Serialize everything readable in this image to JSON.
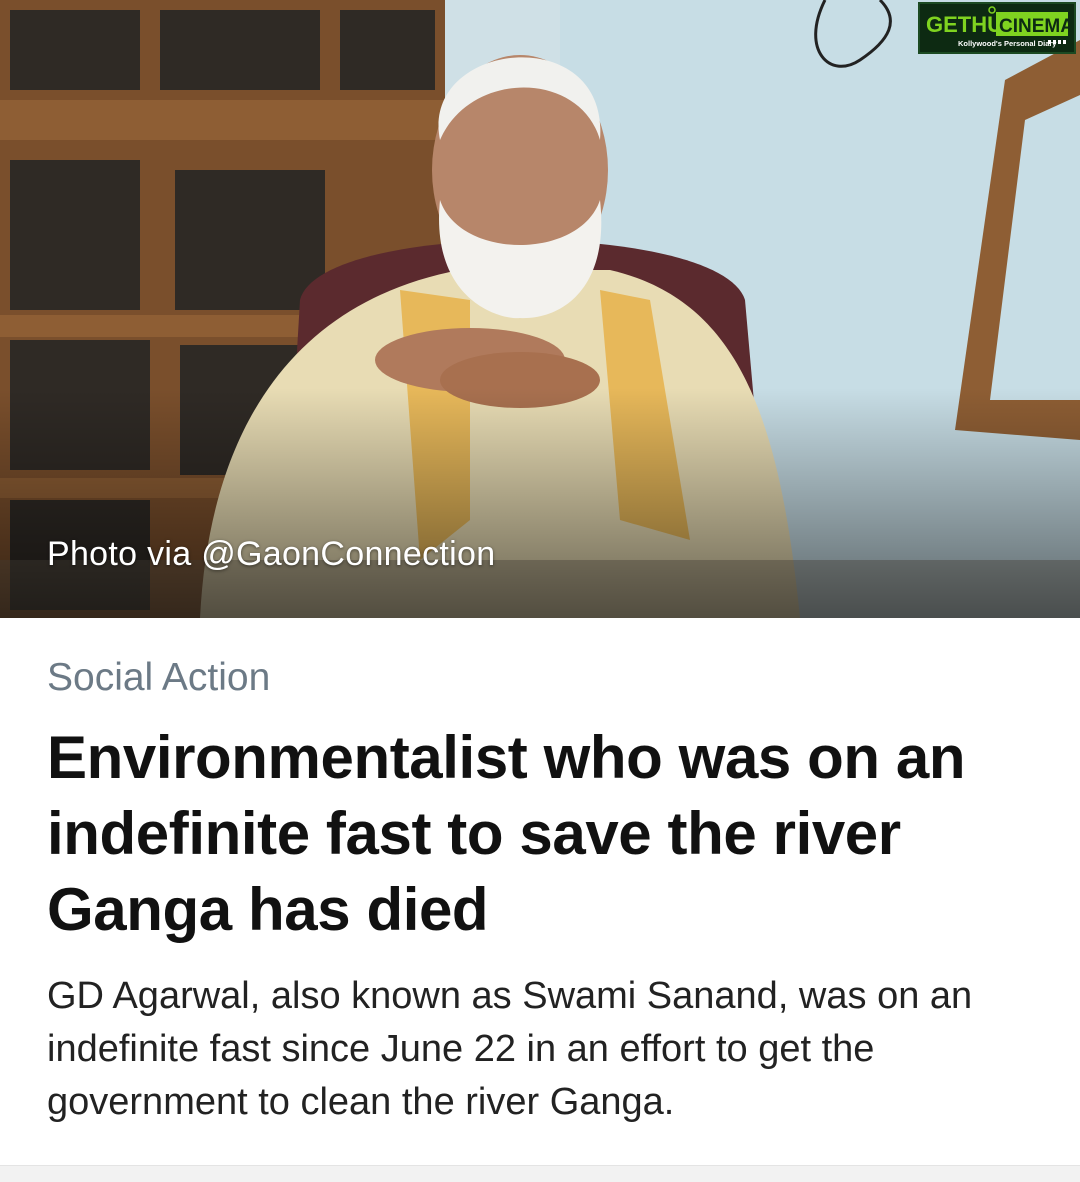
{
  "hero": {
    "photo_credit": "Photo via @GaonConnection"
  },
  "watermark": {
    "brand_left": "GETHU",
    "brand_right": "CINEMA",
    "tagline": "Kollywood's Personal Diary"
  },
  "article": {
    "category": "Social Action",
    "headline": "Environmentalist who was on an indefinite fast to save the river Ganga has died",
    "summary": "GD Agarwal, also known as Swami Sanand, was on an indefinite fast since June 22 in an effort to get the government to clean the river Ganga."
  },
  "colors": {
    "category": "#6c7a86",
    "headline": "#111111",
    "summary": "#222222",
    "watermark_green": "#7fd320"
  }
}
